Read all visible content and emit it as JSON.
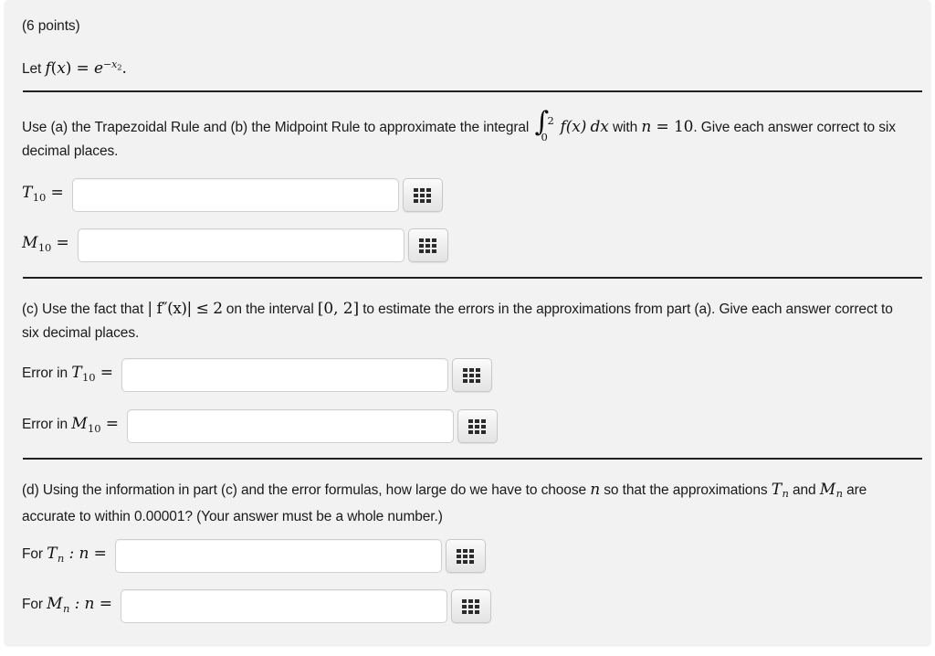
{
  "problem": {
    "points_label": "(6 points)",
    "definition": {
      "lead": "Let ",
      "func": "f",
      "open": "(",
      "var": "x",
      "close": ") = ",
      "base": "e",
      "exponent_sign": "−",
      "exponent_var": "x",
      "exponent_pow": "2",
      "period": "."
    },
    "part_a": {
      "text_1": "Use (a) the Trapezoidal Rule and (b) the Midpoint Rule to approximate the integral ",
      "integral_upper": "2",
      "integral_lower": "0",
      "integrand_f": "f",
      "integrand_x": "(x)",
      "integrand_dx": "dx",
      "text_2": " with ",
      "n_symbol": "n",
      "equals": " = ",
      "n_value": "10",
      "text_3": ". Give each answer correct to six decimal places."
    },
    "part_c": {
      "text_1": "(c) Use the fact that ",
      "math_1": "| f″(x)| ≤ 2",
      "text_2": " on the interval ",
      "math_2": "[0, 2]",
      "text_3": " to estimate the errors in the approximations from part (a). Give each answer correct to six decimal places."
    },
    "part_d": {
      "text_1": "(d) Using the information in part (c) and the error formulas, how large do we have to choose ",
      "n_symbol": "n",
      "text_2": " so that the approximations ",
      "t_symbol": "T",
      "t_sub": "n",
      "text_3": " and ",
      "m_symbol": "M",
      "m_sub": "n",
      "text_4": " are accurate to within 0.00001? (Your answer must be a whole number.)"
    }
  },
  "answers": [
    {
      "id": "t10",
      "label_prefix": "",
      "symbol": "T",
      "subscript": "10",
      "separator": "",
      "equals": " =",
      "value": "",
      "placeholder": "",
      "keypad_icon": "keypad-grid-icon",
      "input_width": 358
    },
    {
      "id": "m10",
      "label_prefix": "",
      "symbol": "M",
      "subscript": "10",
      "separator": "",
      "equals": " =",
      "value": "",
      "placeholder": "",
      "keypad_icon": "keypad-grid-icon",
      "input_width": 358
    },
    {
      "id": "error-t10",
      "label_prefix": "Error in ",
      "symbol": "T",
      "subscript": "10",
      "separator": "",
      "equals": " =",
      "value": "",
      "placeholder": "",
      "keypad_icon": "keypad-grid-icon",
      "input_width": 358
    },
    {
      "id": "error-m10",
      "label_prefix": "Error in ",
      "symbol": "M",
      "subscript": "10",
      "separator": "",
      "equals": " =",
      "value": "",
      "placeholder": "",
      "keypad_icon": "keypad-grid-icon",
      "input_width": 358
    },
    {
      "id": "for-tn",
      "label_prefix": "For ",
      "symbol": "T",
      "subscript": "n",
      "separator": " : n",
      "equals": " =",
      "value": "",
      "placeholder": "",
      "keypad_icon": "keypad-grid-icon",
      "input_width": 358
    },
    {
      "id": "for-mn",
      "label_prefix": "For ",
      "symbol": "M",
      "subscript": "n",
      "separator": " : n",
      "equals": " =",
      "value": "",
      "placeholder": "",
      "keypad_icon": "keypad-grid-icon",
      "input_width": 358
    }
  ],
  "theme": {
    "page_background": "#f2f2f2",
    "text_color": "#1a1a1a",
    "rule_color": "#222222",
    "input_border": "#cfcfcf",
    "input_background": "#ffffff"
  }
}
